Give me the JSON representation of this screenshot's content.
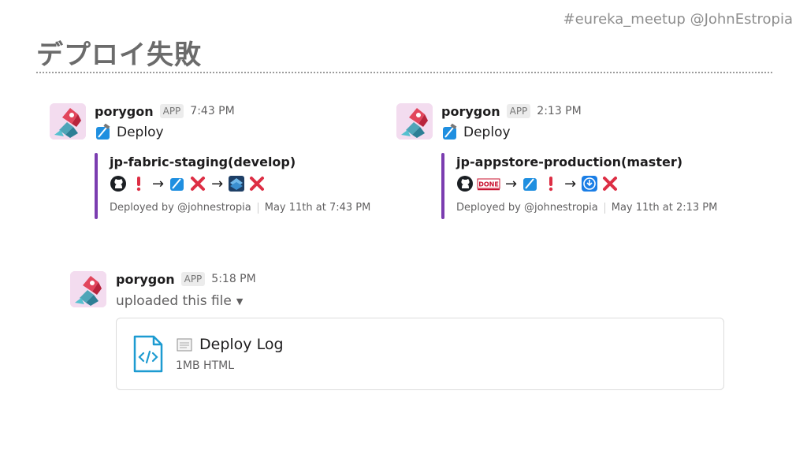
{
  "header": {
    "hashtag": "#eureka_meetup @JohnEstropia",
    "title": "デプロイ失敗"
  },
  "messages": [
    {
      "user": "porygon",
      "badge": "APP",
      "time": "7:43 PM",
      "deploy_label": "Deploy",
      "attachment": {
        "title": "jp-fabric-staging(develop)",
        "pipeline": [
          "github-icon",
          "exclamation-icon",
          "arrow",
          "xcode-icon",
          "cross-icon",
          "arrow",
          "fabric-icon",
          "cross-icon"
        ],
        "deployed_by": "Deployed by @johnestropia",
        "date": "May 11th at 7:43 PM",
        "bar_color": "#7b3db0"
      }
    },
    {
      "user": "porygon",
      "badge": "APP",
      "time": "2:13 PM",
      "deploy_label": "Deploy",
      "attachment": {
        "title": "jp-appstore-production(master)",
        "pipeline": [
          "github-icon",
          "done-icon",
          "arrow",
          "xcode-icon",
          "exclamation-icon",
          "arrow",
          "itunes-connect-icon",
          "cross-icon"
        ],
        "deployed_by": "Deployed by @johnestropia",
        "date": "May 11th at 2:13 PM",
        "bar_color": "#7b3db0"
      }
    },
    {
      "user": "porygon",
      "badge": "APP",
      "time": "5:18 PM",
      "subtitle": "uploaded this file",
      "file": {
        "name": "Deploy Log",
        "meta": "1MB HTML",
        "accent": "#1d9bd1"
      }
    }
  ],
  "icons": {
    "arrow_glyph": "→",
    "done_text": "DONE"
  },
  "colors": {
    "cross": "#dd2e44",
    "exclamation": "#dd2e44",
    "bar": "#7b3db0"
  }
}
